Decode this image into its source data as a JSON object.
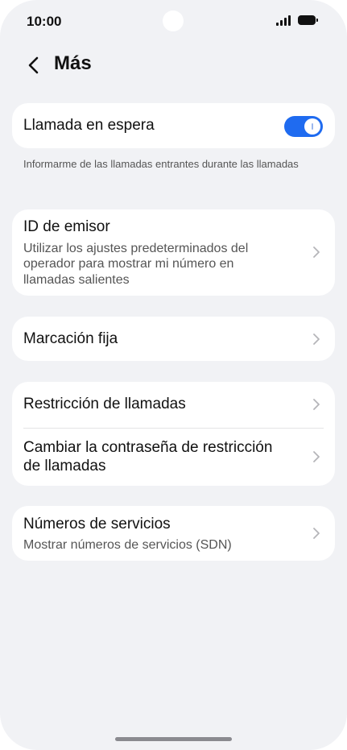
{
  "status_bar": {
    "time": "10:00"
  },
  "header": {
    "title": "Más"
  },
  "call_waiting": {
    "label": "Llamada en espera",
    "enabled": true,
    "note": "Informarme de las llamadas entrantes durante las llamadas"
  },
  "caller_id": {
    "label": "ID de emisor",
    "sub_line1": "Utilizar los ajustes predeterminados del",
    "sub_line2": "operador para mostrar mi número en",
    "sub_line3": "llamadas salientes"
  },
  "fixed_dialing": {
    "label": "Marcación fija"
  },
  "call_barring": {
    "label": "Restricción de llamadas",
    "change_password_line1": "Cambiar la contraseña de restricción",
    "change_password_line2": "de llamadas"
  },
  "service_numbers": {
    "label": "Números de servicios",
    "sub": "Mostrar números de servicios (SDN)"
  },
  "colors": {
    "accent": "#1f6bf0",
    "background": "#f1f2f5",
    "card": "#ffffff"
  }
}
